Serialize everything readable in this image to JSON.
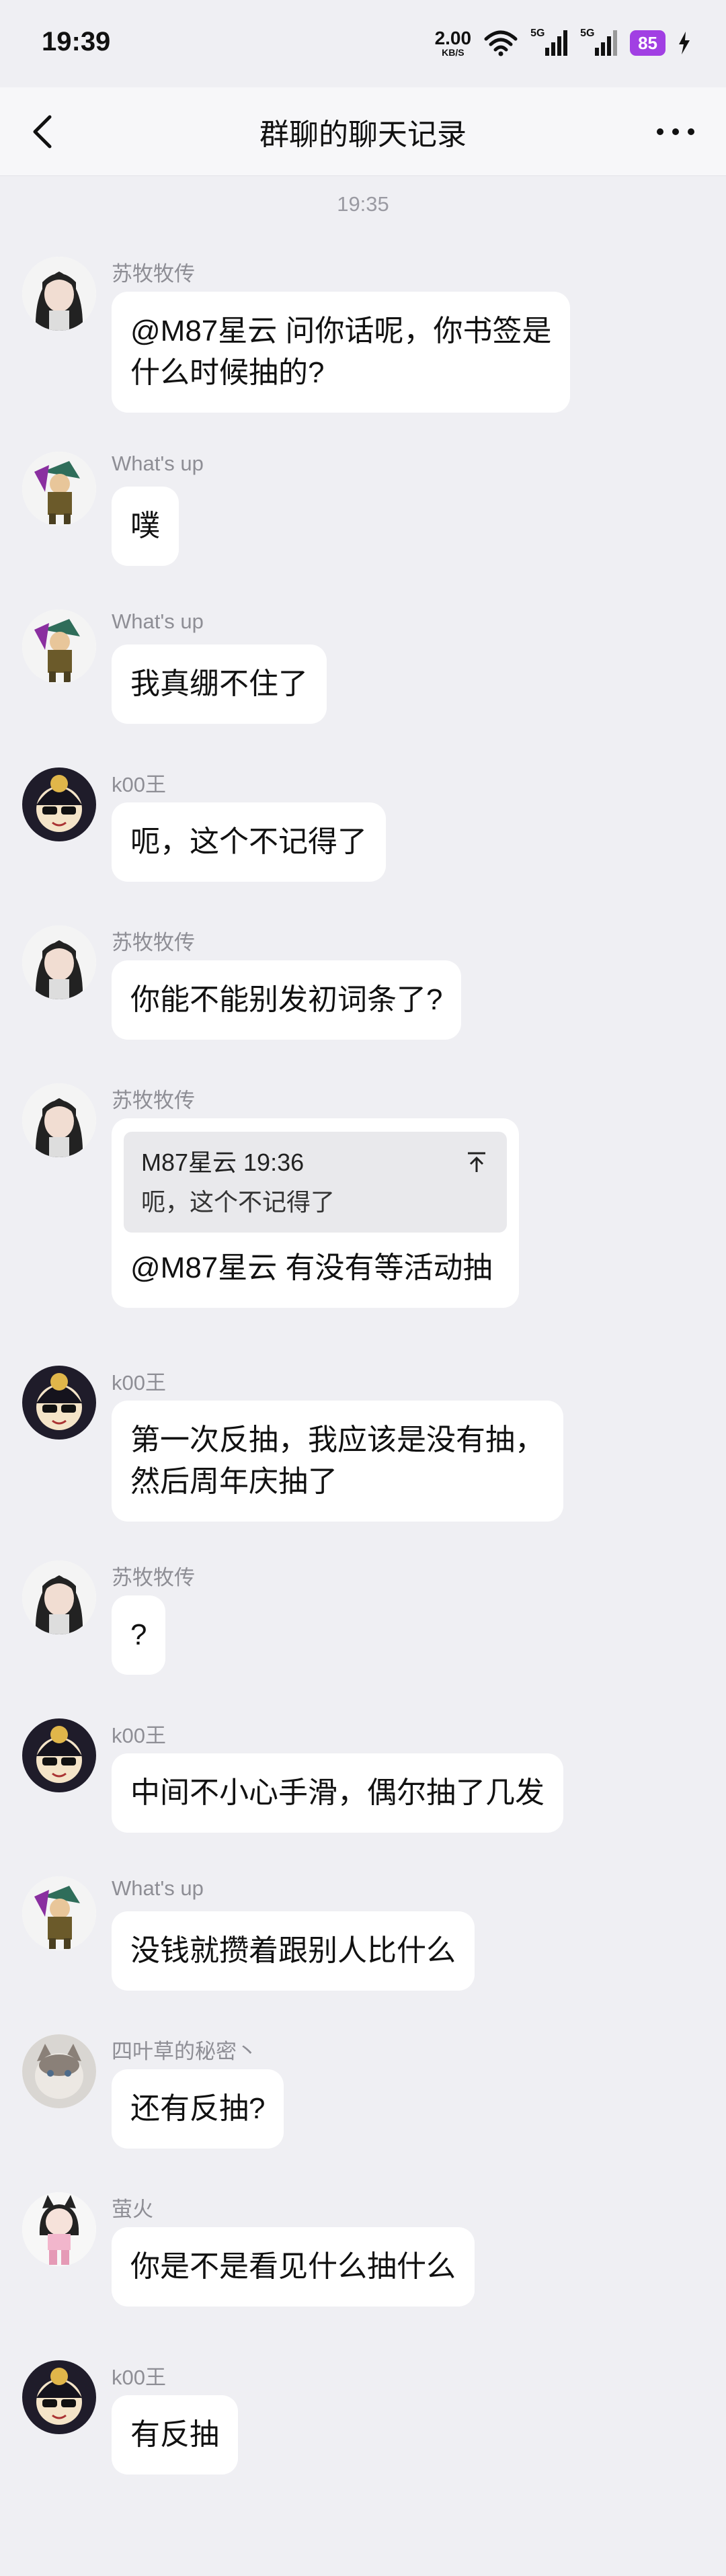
{
  "status_bar": {
    "time": "19:39",
    "net_speed_value": "2.00",
    "net_speed_unit": "KB/S",
    "signal_tags": [
      "5G",
      "5G"
    ],
    "battery": "85"
  },
  "header": {
    "title": "群聊的聊天记录",
    "back_icon": "chevron-left-icon",
    "more_icon": "ellipsis-icon"
  },
  "timestamp": "19:35",
  "colors": {
    "background": "#efeff3",
    "bubble": "#ffffff",
    "battery": "#a13fe3",
    "name": "#8e8e95"
  },
  "messages": [
    {
      "sender": "苏牧牧传",
      "avatar": "anime-girl-avatar",
      "lines": [
        "@M87星云 问你话呢，你书签是",
        "什么时候抽的?"
      ]
    },
    {
      "sender": "What's up",
      "avatar": "jotaro-avatar",
      "lines": [
        "噗"
      ]
    },
    {
      "sender": "What's up",
      "avatar": "jotaro-avatar",
      "lines": [
        "我真绷不住了"
      ]
    },
    {
      "sender": "k00王",
      "avatar": "sunglasses-avatar",
      "lines": [
        "呃，这个不记得了"
      ]
    },
    {
      "sender": "苏牧牧传",
      "avatar": "anime-girl-avatar",
      "lines": [
        "你能不能别发初词条了?"
      ]
    },
    {
      "sender": "苏牧牧传",
      "avatar": "anime-girl-avatar",
      "quote": {
        "head": "M87星云 19:36",
        "text": "呃，这个不记得了",
        "icon": "jump-to-top-icon"
      },
      "lines": [
        "@M87星云 有没有等活动抽"
      ]
    },
    {
      "sender": "k00王",
      "avatar": "sunglasses-avatar",
      "lines": [
        "第一次反抽，我应该是没有抽，",
        "然后周年庆抽了"
      ]
    },
    {
      "sender": "苏牧牧传",
      "avatar": "anime-girl-avatar",
      "lines": [
        "?"
      ]
    },
    {
      "sender": "k00王",
      "avatar": "sunglasses-avatar",
      "lines": [
        "中间不小心手滑，偶尔抽了几发"
      ]
    },
    {
      "sender": "What's up",
      "avatar": "jotaro-avatar",
      "lines": [
        "没钱就攒着跟别人比什么"
      ]
    },
    {
      "sender": "四叶草的秘密丶",
      "avatar": "cat-avatar",
      "lines": [
        "还有反抽?"
      ]
    },
    {
      "sender": "萤火",
      "avatar": "cat-girl-avatar",
      "lines": [
        "你是不是看见什么抽什么"
      ]
    },
    {
      "sender": "k00王",
      "avatar": "sunglasses-avatar",
      "lines": [
        "有反抽"
      ]
    }
  ]
}
